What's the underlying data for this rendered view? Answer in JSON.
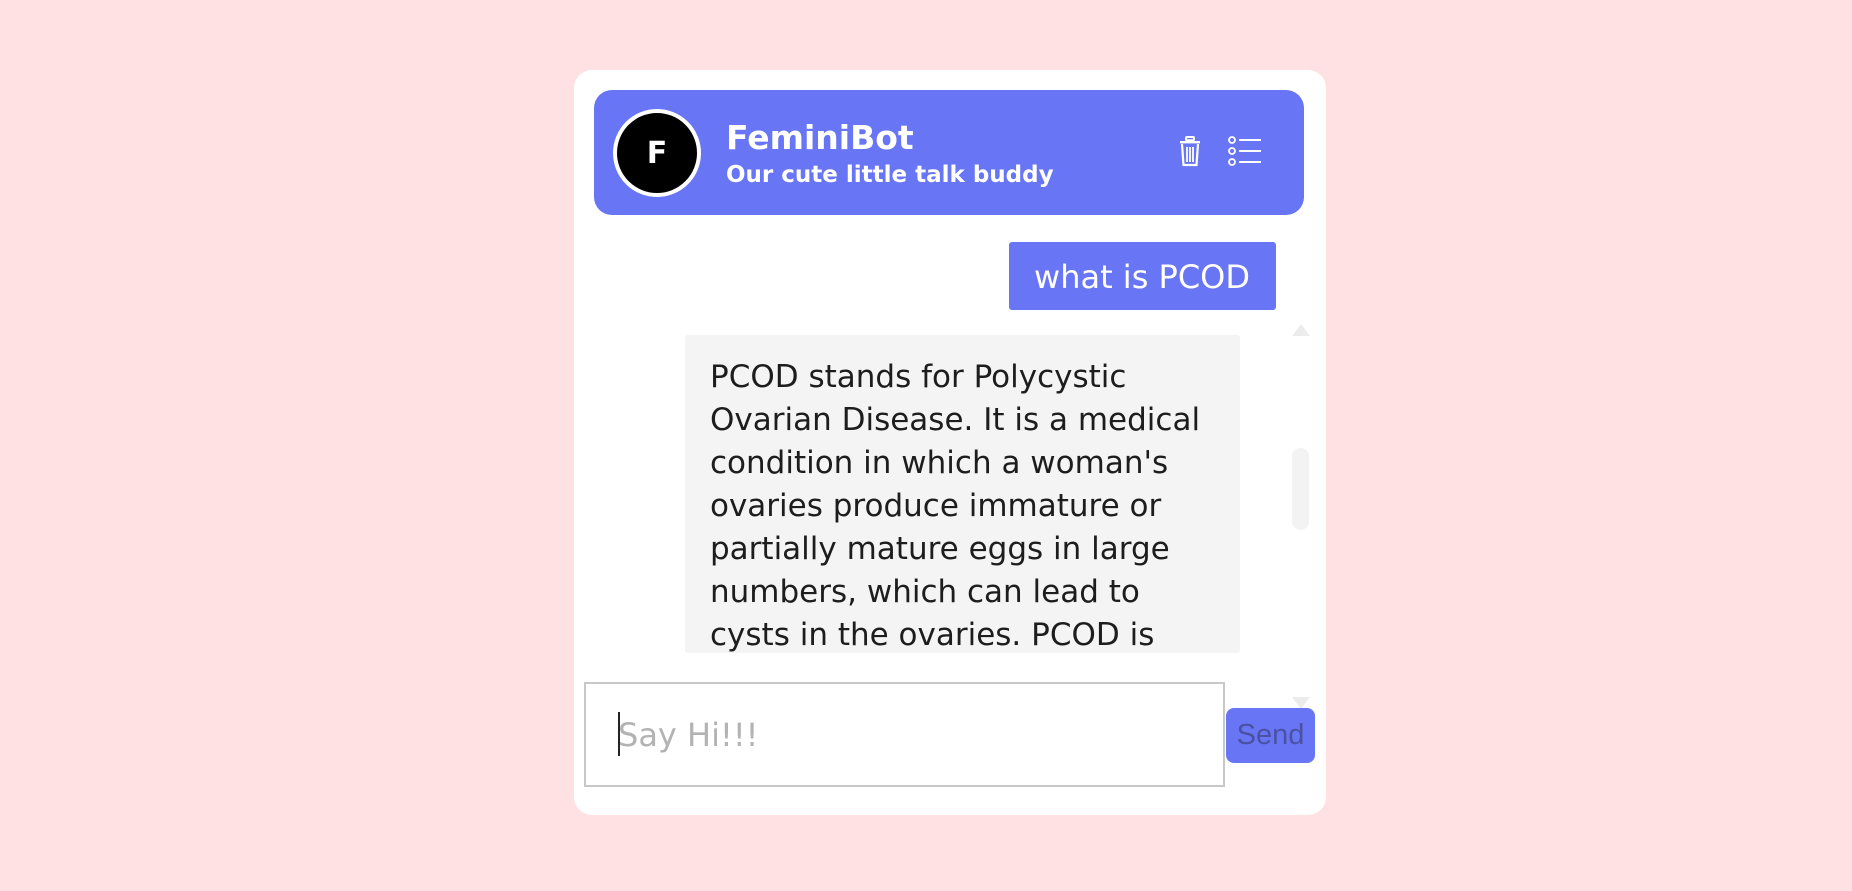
{
  "header": {
    "avatar_letter": "F",
    "title": "FeminiBot",
    "subtitle": "Our cute little talk buddy",
    "icons": [
      "trash-icon",
      "list-icon"
    ]
  },
  "messages": [
    {
      "sender": "user",
      "text": "what is PCOD"
    },
    {
      "sender": "bot",
      "text": "PCOD stands for Polycystic Ovarian Disease. It is a medical condition in which a woman's ovaries produce immature or partially mature eggs in large numbers, which can lead to cysts in the ovaries. PCOD is"
    }
  ],
  "composer": {
    "placeholder": "Say Hi!!!",
    "value": "",
    "send_label": "Send"
  },
  "colors": {
    "page_background": "#ffe1e3",
    "accent": "#6875f5",
    "bot_bubble": "#f4f4f4"
  }
}
